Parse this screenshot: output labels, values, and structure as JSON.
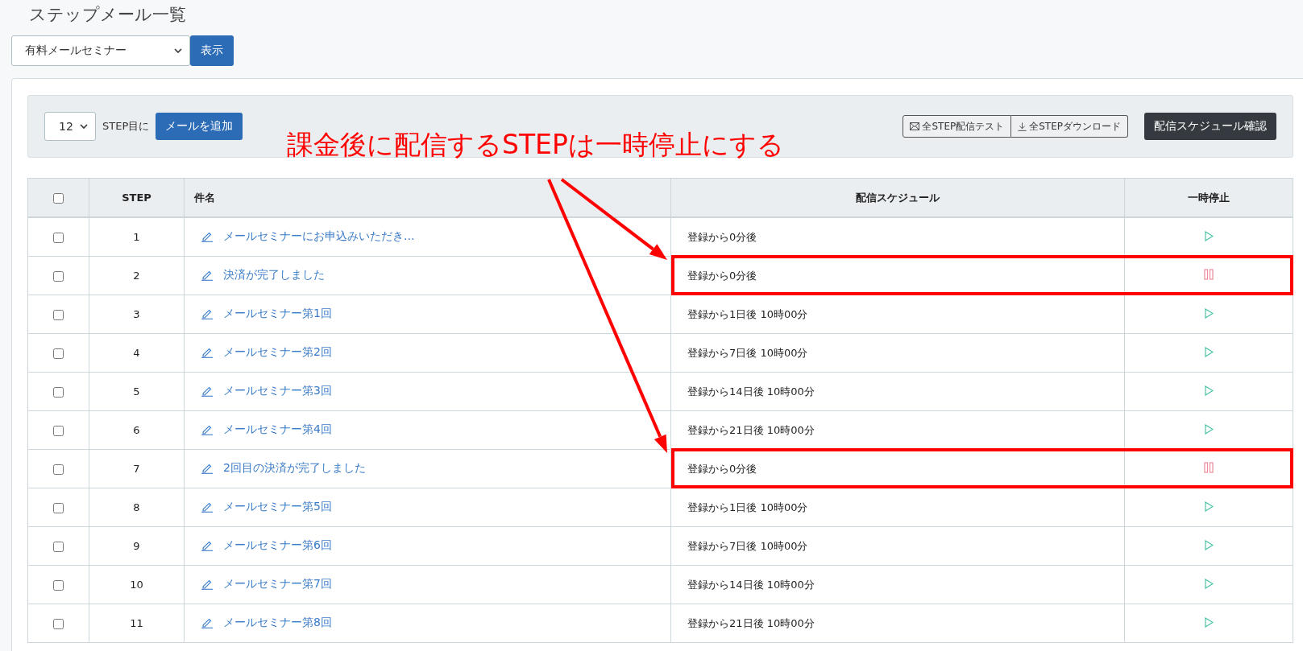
{
  "page_title": "ステップメール一覧",
  "series_select": {
    "value": "有料メールセミナー"
  },
  "show_button": "表示",
  "toolbar": {
    "step_select": {
      "value": "12"
    },
    "step_label": "STEP目に",
    "add_button": "メールを追加",
    "test_button": "全STEP配信テスト",
    "download_button": "全STEPダウンロード",
    "schedule_button": "配信スケジュール確認"
  },
  "table": {
    "select_all_checked": false,
    "columns": [
      "STEP",
      "件名",
      "配信スケジュール",
      "一時停止"
    ],
    "rows": [
      {
        "checked": false,
        "step": "1",
        "subject": "メールセミナーにお申込みいただき...",
        "schedule": "登録から0分後",
        "paused": false,
        "highlighted": false
      },
      {
        "checked": false,
        "step": "2",
        "subject": "決済が完了しました",
        "schedule": "登録から0分後",
        "paused": true,
        "highlighted": true
      },
      {
        "checked": false,
        "step": "3",
        "subject": "メールセミナー第1回",
        "schedule": "登録から1日後 10時00分",
        "paused": false,
        "highlighted": false
      },
      {
        "checked": false,
        "step": "4",
        "subject": "メールセミナー第2回",
        "schedule": "登録から7日後 10時00分",
        "paused": false,
        "highlighted": false
      },
      {
        "checked": false,
        "step": "5",
        "subject": "メールセミナー第3回",
        "schedule": "登録から14日後 10時00分",
        "paused": false,
        "highlighted": false
      },
      {
        "checked": false,
        "step": "6",
        "subject": "メールセミナー第4回",
        "schedule": "登録から21日後 10時00分",
        "paused": false,
        "highlighted": false
      },
      {
        "checked": false,
        "step": "7",
        "subject": "2回目の決済が完了しました",
        "schedule": "登録から0分後",
        "paused": true,
        "highlighted": true
      },
      {
        "checked": false,
        "step": "8",
        "subject": "メールセミナー第5回",
        "schedule": "登録から1日後 10時00分",
        "paused": false,
        "highlighted": false
      },
      {
        "checked": false,
        "step": "9",
        "subject": "メールセミナー第6回",
        "schedule": "登録から7日後 10時00分",
        "paused": false,
        "highlighted": false
      },
      {
        "checked": false,
        "step": "10",
        "subject": "メールセミナー第7回",
        "schedule": "登録から14日後 10時00分",
        "paused": false,
        "highlighted": false
      },
      {
        "checked": false,
        "step": "11",
        "subject": "メールセミナー第8回",
        "schedule": "登録から21日後 10時00分",
        "paused": false,
        "highlighted": false
      }
    ]
  },
  "annotation": {
    "text": "課金後に配信するSTEPは一時停止にする"
  }
}
